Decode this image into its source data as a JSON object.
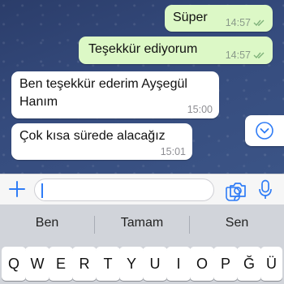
{
  "messages": [
    {
      "text": "Süper",
      "time": "14:57",
      "direction": "out",
      "status": "read"
    },
    {
      "text": "Teşekkür ediyorum",
      "time": "14:57",
      "direction": "out",
      "status": "read"
    },
    {
      "line1": "Ben teşekkür ederim Ayşegül",
      "line2": "Hanım",
      "time": "15:00",
      "direction": "in"
    },
    {
      "text": "Çok kısa sürede alacağız",
      "time": "15:01",
      "direction": "in"
    }
  ],
  "composer": {
    "placeholder": ""
  },
  "suggestions": [
    "Ben",
    "Tamam",
    "Sen"
  ],
  "keys": [
    "Q",
    "W",
    "E",
    "R",
    "T",
    "Y",
    "U",
    "I",
    "O",
    "P",
    "Ğ",
    "Ü"
  ],
  "colors": {
    "accent": "#2f7cf6",
    "out_bubble": "#dcf8c6",
    "read_tick": "#7fb27a"
  },
  "icons": {
    "scroll": "chevron-down-icon",
    "add": "plus-icon",
    "sticker": "sticker-icon",
    "camera": "camera-icon",
    "mic": "microphone-icon"
  }
}
